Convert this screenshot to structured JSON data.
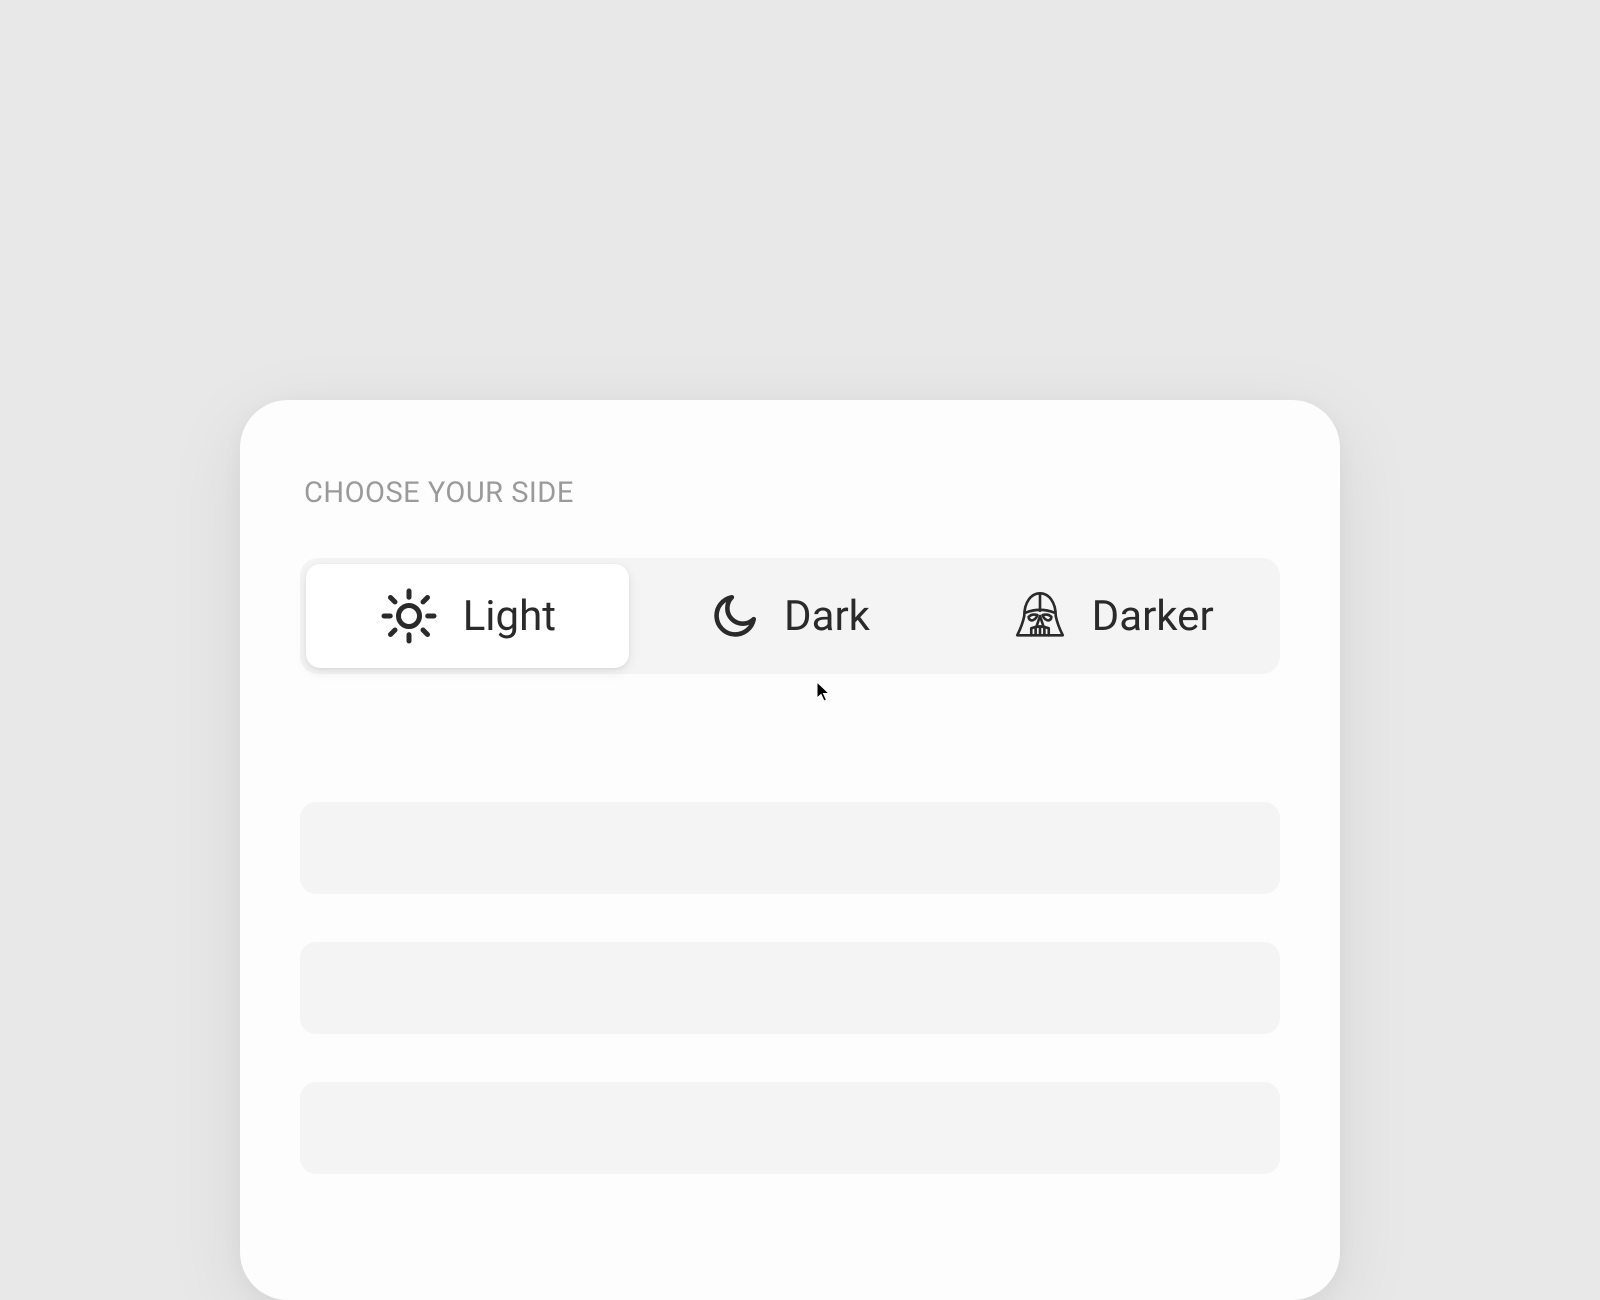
{
  "title": "CHOOSE YOUR SIDE",
  "options": [
    {
      "label": "Light",
      "icon": "sun-icon",
      "active": true
    },
    {
      "label": "Dark",
      "icon": "moon-icon",
      "active": false
    },
    {
      "label": "Darker",
      "icon": "darth-vader-icon",
      "active": false
    }
  ]
}
